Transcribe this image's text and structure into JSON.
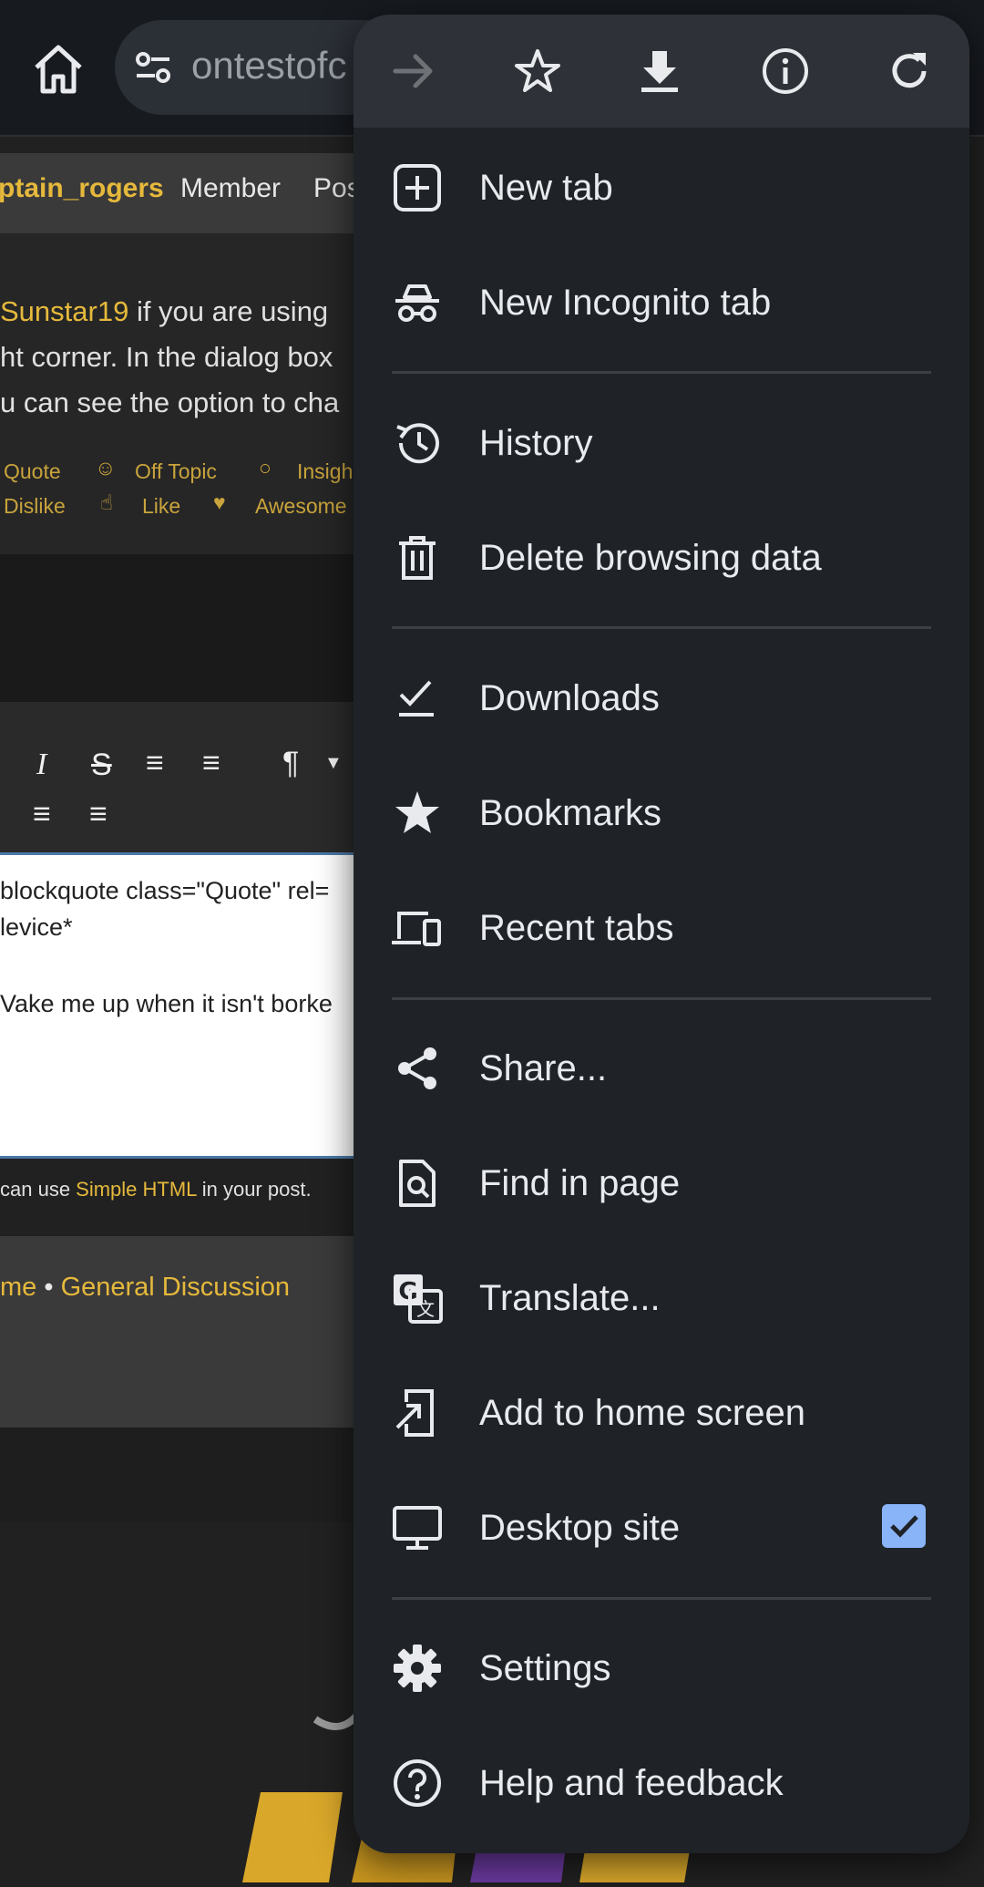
{
  "browser": {
    "url_text": "ontestofc"
  },
  "page": {
    "member_name": "ptain_rogers",
    "member_role": "Member",
    "member_extra": "Pos",
    "post_mention": "Sunstar19",
    "post_line1_rest": " if you are using",
    "post_line2": "ht corner. In the dialog box",
    "post_line3": "u can see the option to cha",
    "reactions": {
      "quote": "Quote",
      "off_topic": "Off Topic",
      "insightful": "Insigh",
      "dislike": "Dislike",
      "like": "Like",
      "awesome": "Awesome"
    },
    "editor_lines": [
      "blockquote class=\"Quote\" rel=",
      "levice*",
      "Vake me up when it isn't borke"
    ],
    "hint_prefix": " can use ",
    "hint_link": "Simple HTML",
    "hint_suffix": " in your post.",
    "breadcrumb_home": "me",
    "breadcrumb_sep": " • ",
    "breadcrumb_category": "General Discussion"
  },
  "menu": {
    "items": [
      {
        "label": "New tab"
      },
      {
        "label": "New Incognito tab"
      },
      {
        "label": "History"
      },
      {
        "label": "Delete browsing data"
      },
      {
        "label": "Downloads"
      },
      {
        "label": "Bookmarks"
      },
      {
        "label": "Recent tabs"
      },
      {
        "label": "Share..."
      },
      {
        "label": "Find in page"
      },
      {
        "label": "Translate..."
      },
      {
        "label": "Add to home screen"
      },
      {
        "label": "Desktop site",
        "checked": true
      },
      {
        "label": "Settings"
      },
      {
        "label": "Help and feedback"
      }
    ]
  },
  "colors": {
    "menu_bg": "#1f2328",
    "menu_top_bg": "#2e3238",
    "accent_gold": "#e6b93c",
    "checkbox_blue": "#8ab4f8"
  }
}
